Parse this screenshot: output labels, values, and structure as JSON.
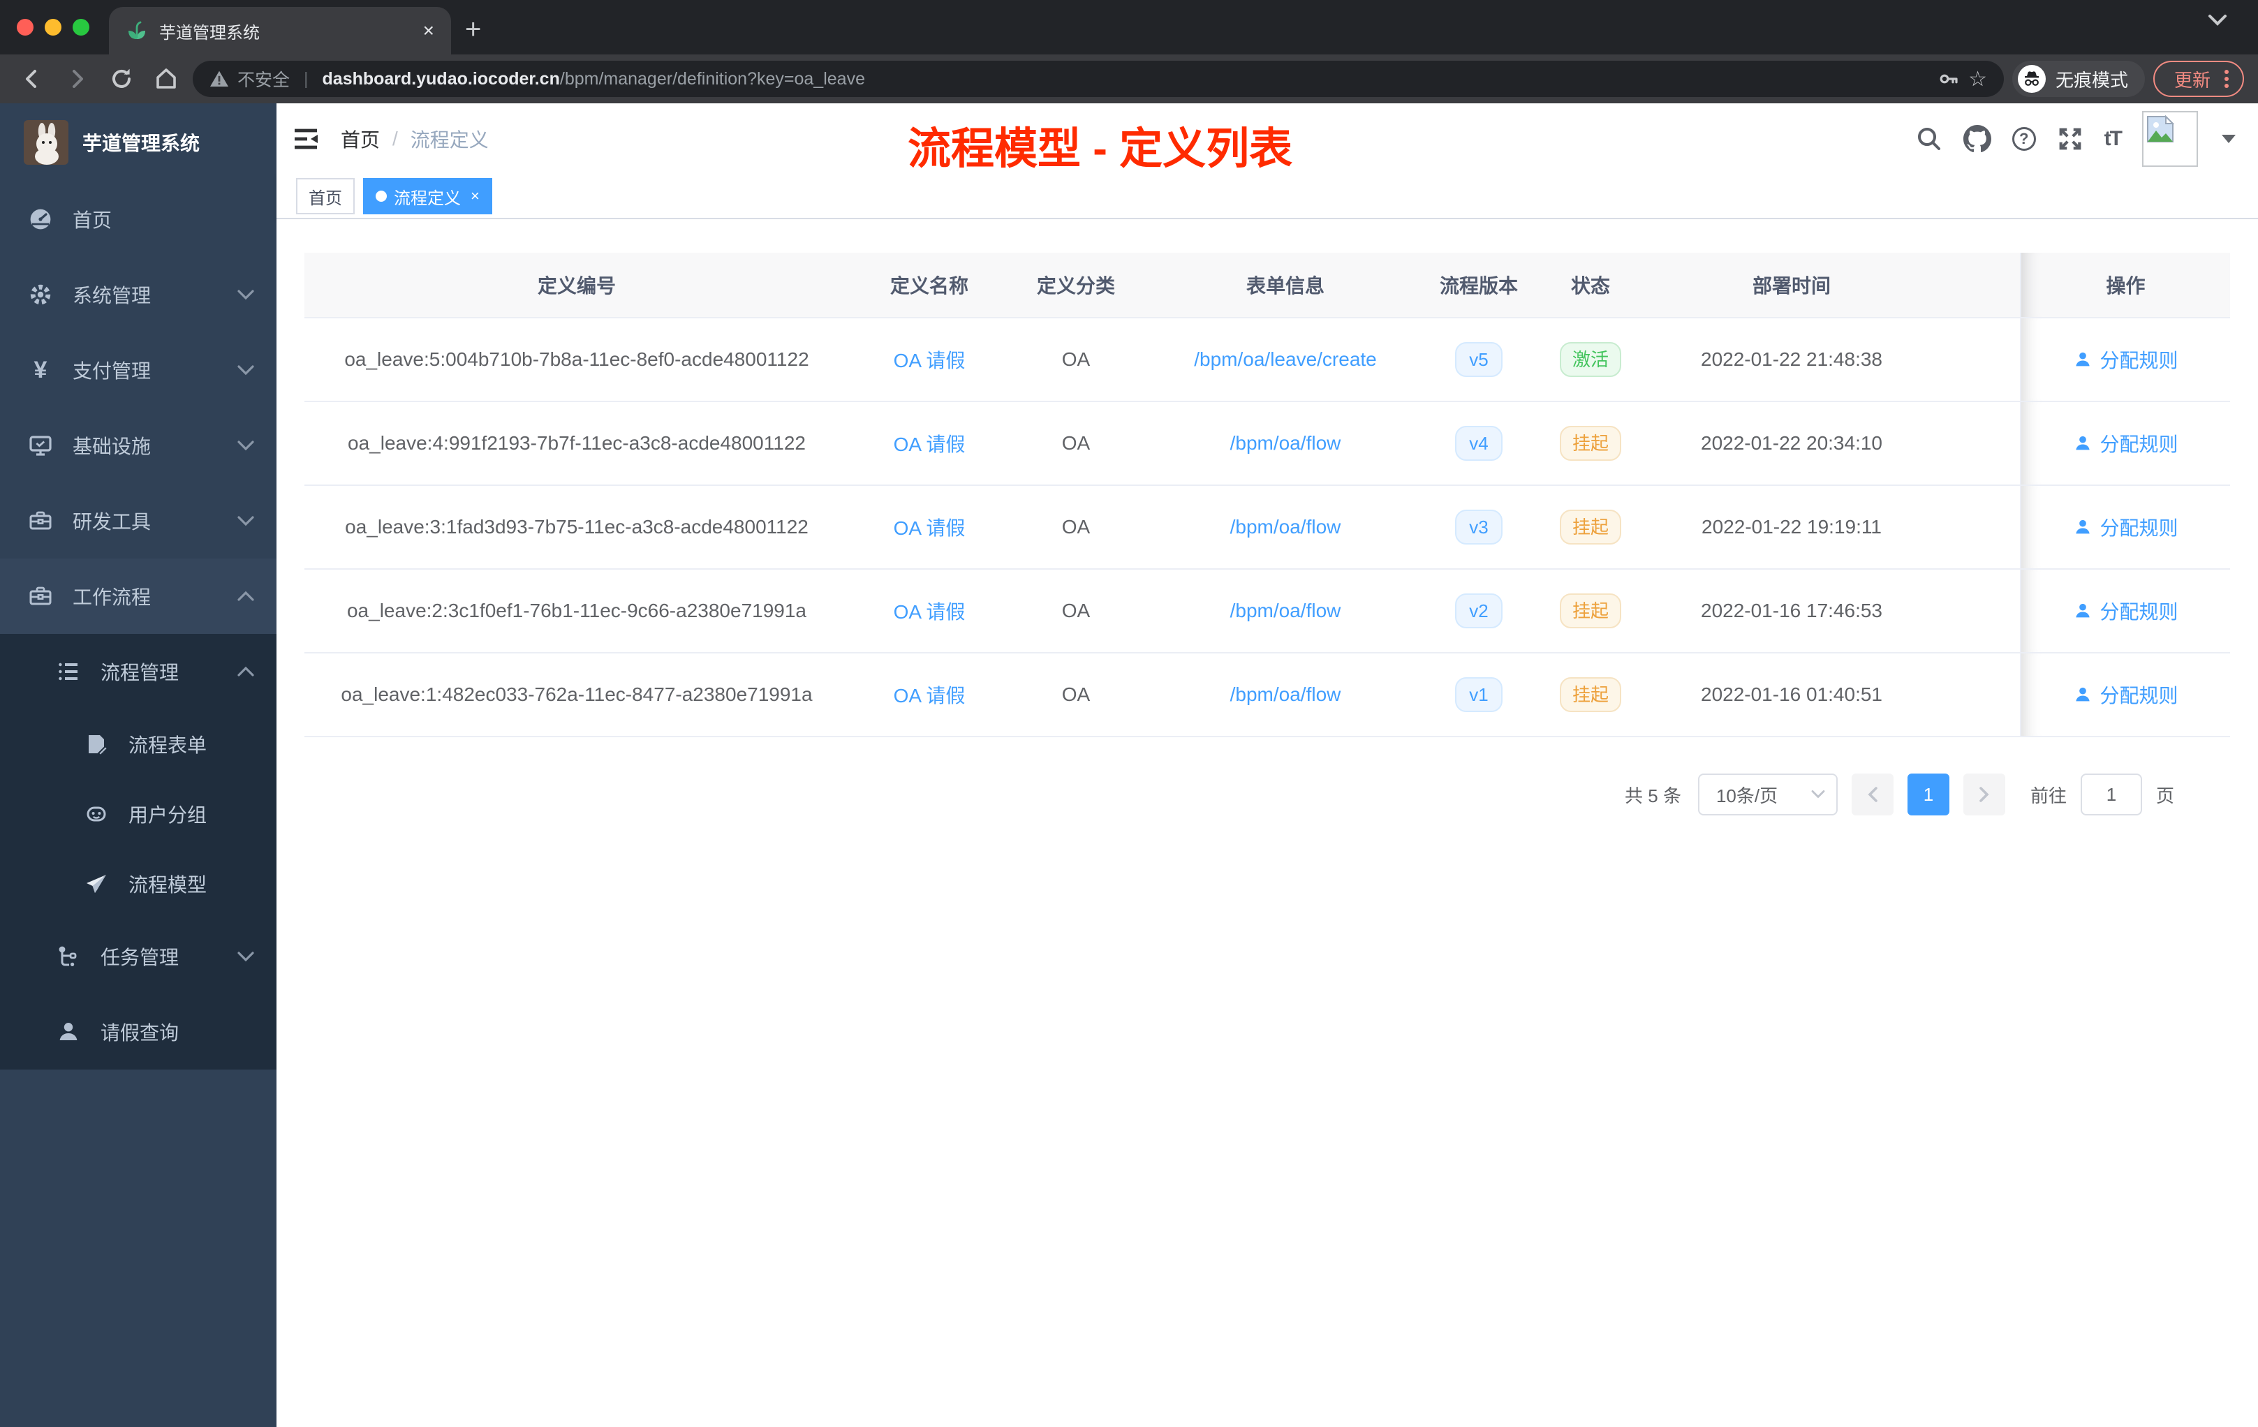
{
  "browser": {
    "tab_title": "芋道管理系统",
    "insecure": "不安全",
    "url_domain": "dashboard.yudao.iocoder.cn",
    "url_path": "/bpm/manager/definition?key=oa_leave",
    "incognito": "无痕模式",
    "update": "更新"
  },
  "glyphs": {
    "close": "×",
    "plus": "+",
    "question": "?",
    "font_size": "tT",
    "star": "☆"
  },
  "sidebar": {
    "title": "芋道管理系统",
    "menu": [
      {
        "label": "首页"
      },
      {
        "label": "系统管理"
      },
      {
        "label": "支付管理"
      },
      {
        "label": "基础设施"
      },
      {
        "label": "研发工具"
      },
      {
        "label": "工作流程"
      }
    ],
    "workflow": {
      "process_mgmt": "流程管理",
      "children": [
        "流程表单",
        "用户分组",
        "流程模型"
      ],
      "task_mgmt": "任务管理",
      "leave_query": "请假查询"
    }
  },
  "header": {
    "breadcrumb_home": "首页",
    "breadcrumb_sep": "/",
    "breadcrumb_current": "流程定义",
    "annotation": "流程模型 - 定义列表"
  },
  "tags": [
    {
      "label": "首页"
    },
    {
      "label": "流程定义"
    }
  ],
  "table": {
    "columns": [
      "定义编号",
      "定义名称",
      "定义分类",
      "表单信息",
      "流程版本",
      "状态",
      "部署时间",
      "操作"
    ],
    "rows": [
      {
        "id": "oa_leave:5:004b710b-7b8a-11ec-8ef0-acde48001122",
        "name": "OA 请假",
        "category": "OA",
        "form": "/bpm/oa/leave/create",
        "version": "v5",
        "status": "激活",
        "status_type": "success",
        "deployed_at": "2022-01-22 21:48:38",
        "action": "分配规则"
      },
      {
        "id": "oa_leave:4:991f2193-7b7f-11ec-a3c8-acde48001122",
        "name": "OA 请假",
        "category": "OA",
        "form": "/bpm/oa/flow",
        "version": "v4",
        "status": "挂起",
        "status_type": "warning",
        "deployed_at": "2022-01-22 20:34:10",
        "action": "分配规则"
      },
      {
        "id": "oa_leave:3:1fad3d93-7b75-11ec-a3c8-acde48001122",
        "name": "OA 请假",
        "category": "OA",
        "form": "/bpm/oa/flow",
        "version": "v3",
        "status": "挂起",
        "status_type": "warning",
        "deployed_at": "2022-01-22 19:19:11",
        "action": "分配规则"
      },
      {
        "id": "oa_leave:2:3c1f0ef1-76b1-11ec-9c66-a2380e71991a",
        "name": "OA 请假",
        "category": "OA",
        "form": "/bpm/oa/flow",
        "version": "v2",
        "status": "挂起",
        "status_type": "warning",
        "deployed_at": "2022-01-16 17:46:53",
        "action": "分配规则"
      },
      {
        "id": "oa_leave:1:482ec033-762a-11ec-8477-a2380e71991a",
        "name": "OA 请假",
        "category": "OA",
        "form": "/bpm/oa/flow",
        "version": "v1",
        "status": "挂起",
        "status_type": "warning",
        "deployed_at": "2022-01-16 01:40:51",
        "action": "分配规则"
      }
    ]
  },
  "pagination": {
    "total": "共 5 条",
    "page_size": "10条/页",
    "page": "1",
    "goto_label": "前往",
    "goto_value": "1",
    "page_suffix": "页"
  },
  "colors": {
    "accent": "#409eff",
    "success": "#42c45c",
    "warning": "#eda13c",
    "annotation": "#ff2b00",
    "sidebar_bg": "#304156",
    "submenu_bg": "#1f2d3d"
  }
}
